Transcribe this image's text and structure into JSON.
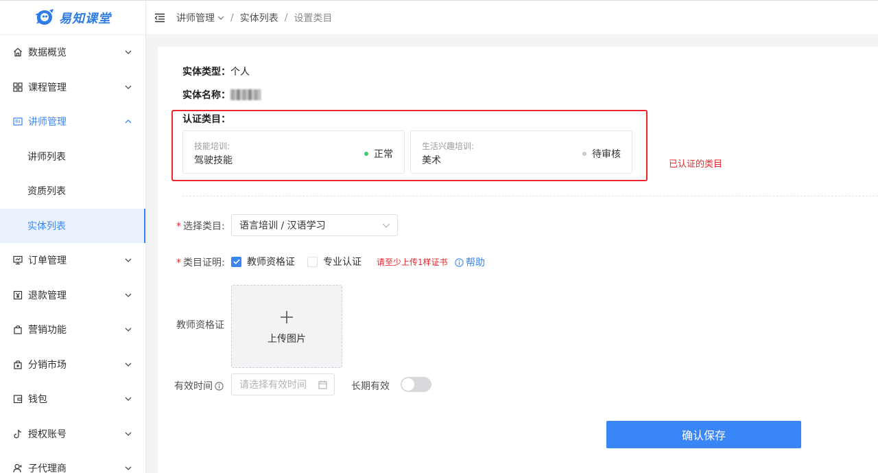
{
  "logo": {
    "text": "易知课堂"
  },
  "sidebar": {
    "items": [
      {
        "label": "数据概览",
        "icon": "home-icon"
      },
      {
        "label": "课程管理",
        "icon": "grid-icon"
      },
      {
        "label": "讲师管理",
        "icon": "id-card-icon",
        "open": true,
        "children": [
          {
            "label": "讲师列表"
          },
          {
            "label": "资质列表"
          },
          {
            "label": "实体列表",
            "active": true
          }
        ]
      },
      {
        "label": "订单管理",
        "icon": "monitor-icon"
      },
      {
        "label": "退款管理",
        "icon": "yen-icon"
      },
      {
        "label": "营销功能",
        "icon": "bag-icon"
      },
      {
        "label": "分销市场",
        "icon": "lock-bag-icon"
      },
      {
        "label": "钱包",
        "icon": "wallet-icon"
      },
      {
        "label": "授权账号",
        "icon": "tiktok-icon"
      },
      {
        "label": "子代理商",
        "icon": "user-icon"
      }
    ]
  },
  "header": {
    "breadcrumb": [
      "讲师管理",
      "实体列表",
      "设置类目"
    ]
  },
  "entity": {
    "type_label": "实体类型：",
    "type_value": "个人",
    "name_label": "实体名称："
  },
  "certified": {
    "title": "认证类目：",
    "cards": [
      {
        "category": "技能培训:",
        "name": "驾驶技能",
        "status": "正常",
        "status_color": "#3ec96b"
      },
      {
        "category": "生活兴趣培训:",
        "name": "美术",
        "status": "待审核",
        "status_color": "#c8c9cc"
      }
    ],
    "annotation": "已认证的类目"
  },
  "form": {
    "category_label": "选择类目:",
    "category_value": "语言培训 / 汉语学习",
    "proof_label": "类目证明:",
    "proof_options": [
      {
        "label": "教师资格证",
        "checked": true
      },
      {
        "label": "专业认证",
        "checked": false
      }
    ],
    "hint": "请至少上传1样证书",
    "help": "帮助",
    "upload_label": "教师资格证",
    "upload_text": "上传图片",
    "valid_label": "有效时间",
    "valid_placeholder": "请选择有效时间",
    "long_term_label": "长期有效",
    "long_term": false,
    "submit": "确认保存"
  },
  "colors": {
    "accent": "#3a86f5",
    "danger": "#e8262b"
  }
}
